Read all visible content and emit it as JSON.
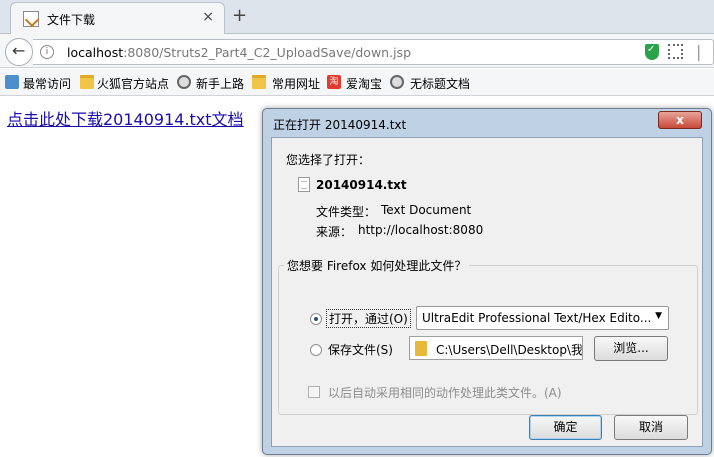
{
  "browser": {
    "tab_title": "文件下载",
    "tab_close": "×",
    "new_tab": "+",
    "back": "←",
    "url_host": "localhost",
    "url_rest": ":8080/Struts2_Part4_C2_UploadSave/down.jsp",
    "info": "i",
    "more": "|"
  },
  "bookmarks": [
    {
      "label": "最常访问",
      "icon": "most-visited-icon"
    },
    {
      "label": "火狐官方站点",
      "icon": "folder-icon"
    },
    {
      "label": "新手上路",
      "icon": "globe-icon"
    },
    {
      "label": "常用网址",
      "icon": "folder-icon"
    },
    {
      "label": "爱淘宝",
      "icon": "taobao-icon",
      "glyph": "淘"
    },
    {
      "label": "无标题文档",
      "icon": "globe-icon"
    }
  ],
  "page": {
    "download_link": "点击此处下载20140914.txt文档"
  },
  "dialog": {
    "title": "正在打开 20140914.txt",
    "close": "x",
    "chose_label": "您选择了打开：",
    "filename": "20140914.txt",
    "type_label": "文件类型：",
    "type_value": "Text Document",
    "source_label": "来源：",
    "source_value": "http://localhost:8080",
    "question": "您想要 Firefox 如何处理此文件？",
    "open_with_label": "打开，通过(O)",
    "open_with_app": "UltraEdit Professional Text/Hex Edito...",
    "dropdown_arrow": "▼",
    "save_label": "保存文件(S)",
    "save_path": "C:\\Users\\Dell\\Desktop\\我的",
    "browse_label": "浏览...",
    "auto_label": "以后自动采用相同的动作处理此类文件。(A)",
    "ok_label": "确定",
    "cancel_label": "取消",
    "selected_option": "open_with"
  }
}
